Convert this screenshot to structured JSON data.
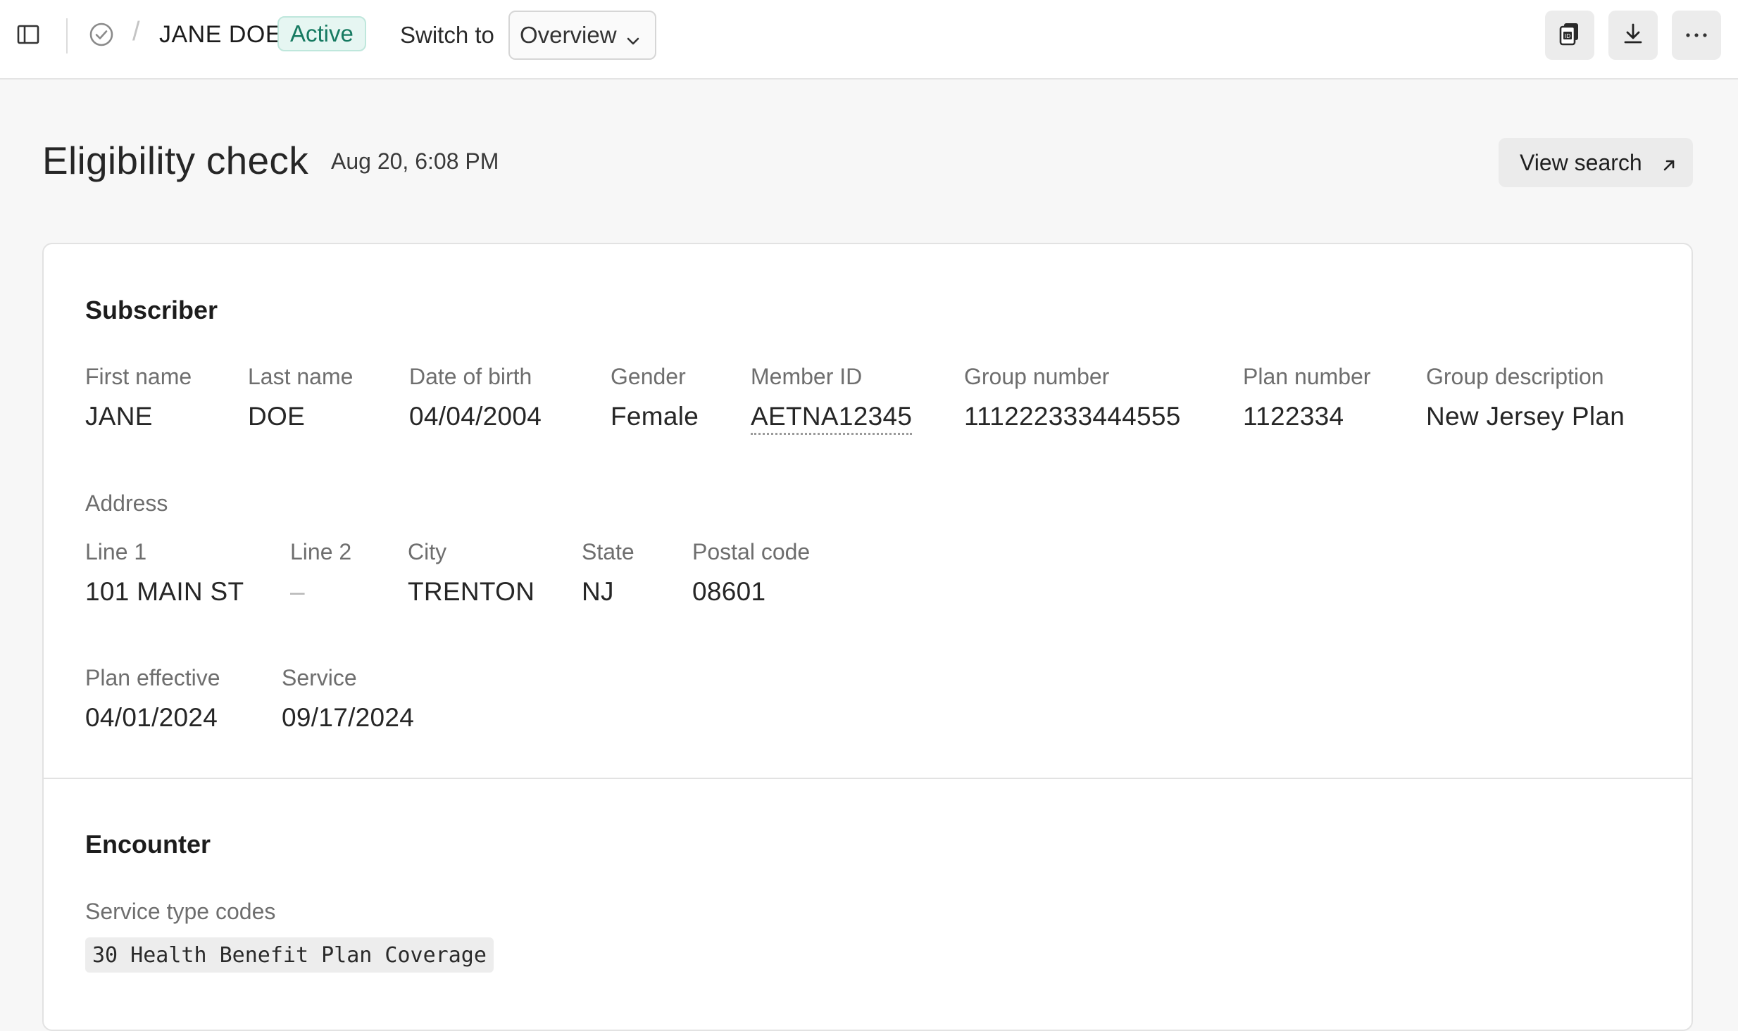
{
  "topbar": {
    "patient_name": "JANE DOE",
    "status": "Active",
    "switch_label": "Switch to",
    "switch_value": "Overview",
    "icons": [
      "sidebar-toggle-icon",
      "check-circle-icon",
      "id-card-icon",
      "download-icon",
      "more-icon"
    ]
  },
  "header": {
    "title": "Eligibility check",
    "timestamp": "Aug 20, 6:08 PM",
    "view_search_label": "View search"
  },
  "subscriber": {
    "title": "Subscriber",
    "fields": [
      {
        "label": "First name",
        "value": "JANE"
      },
      {
        "label": "Last name",
        "value": "DOE"
      },
      {
        "label": "Date of birth",
        "value": "04/04/2004"
      },
      {
        "label": "Gender",
        "value": "Female"
      },
      {
        "label": "Member ID",
        "value": "AETNA12345"
      },
      {
        "label": "Group number",
        "value": "111222333444555"
      },
      {
        "label": "Plan number",
        "value": "1122334"
      },
      {
        "label": "Group description",
        "value": "New Jersey Plan"
      }
    ],
    "address": {
      "title": "Address",
      "fields": [
        {
          "label": "Line 1",
          "value": "101 MAIN ST"
        },
        {
          "label": "Line 2",
          "value": "–"
        },
        {
          "label": "City",
          "value": "TRENTON"
        },
        {
          "label": "State",
          "value": "NJ"
        },
        {
          "label": "Postal code",
          "value": "08601"
        }
      ]
    },
    "dates": [
      {
        "label": "Plan effective",
        "value": "04/01/2024"
      },
      {
        "label": "Service",
        "value": "09/17/2024"
      }
    ]
  },
  "encounter": {
    "title": "Encounter",
    "service_type_label": "Service type codes",
    "service_type_codes": [
      "30 Health Benefit Plan Coverage"
    ]
  },
  "colors": {
    "status_bg": "#e6f6f2",
    "status_text": "#167a61",
    "page_bg": "#f7f7f7"
  }
}
